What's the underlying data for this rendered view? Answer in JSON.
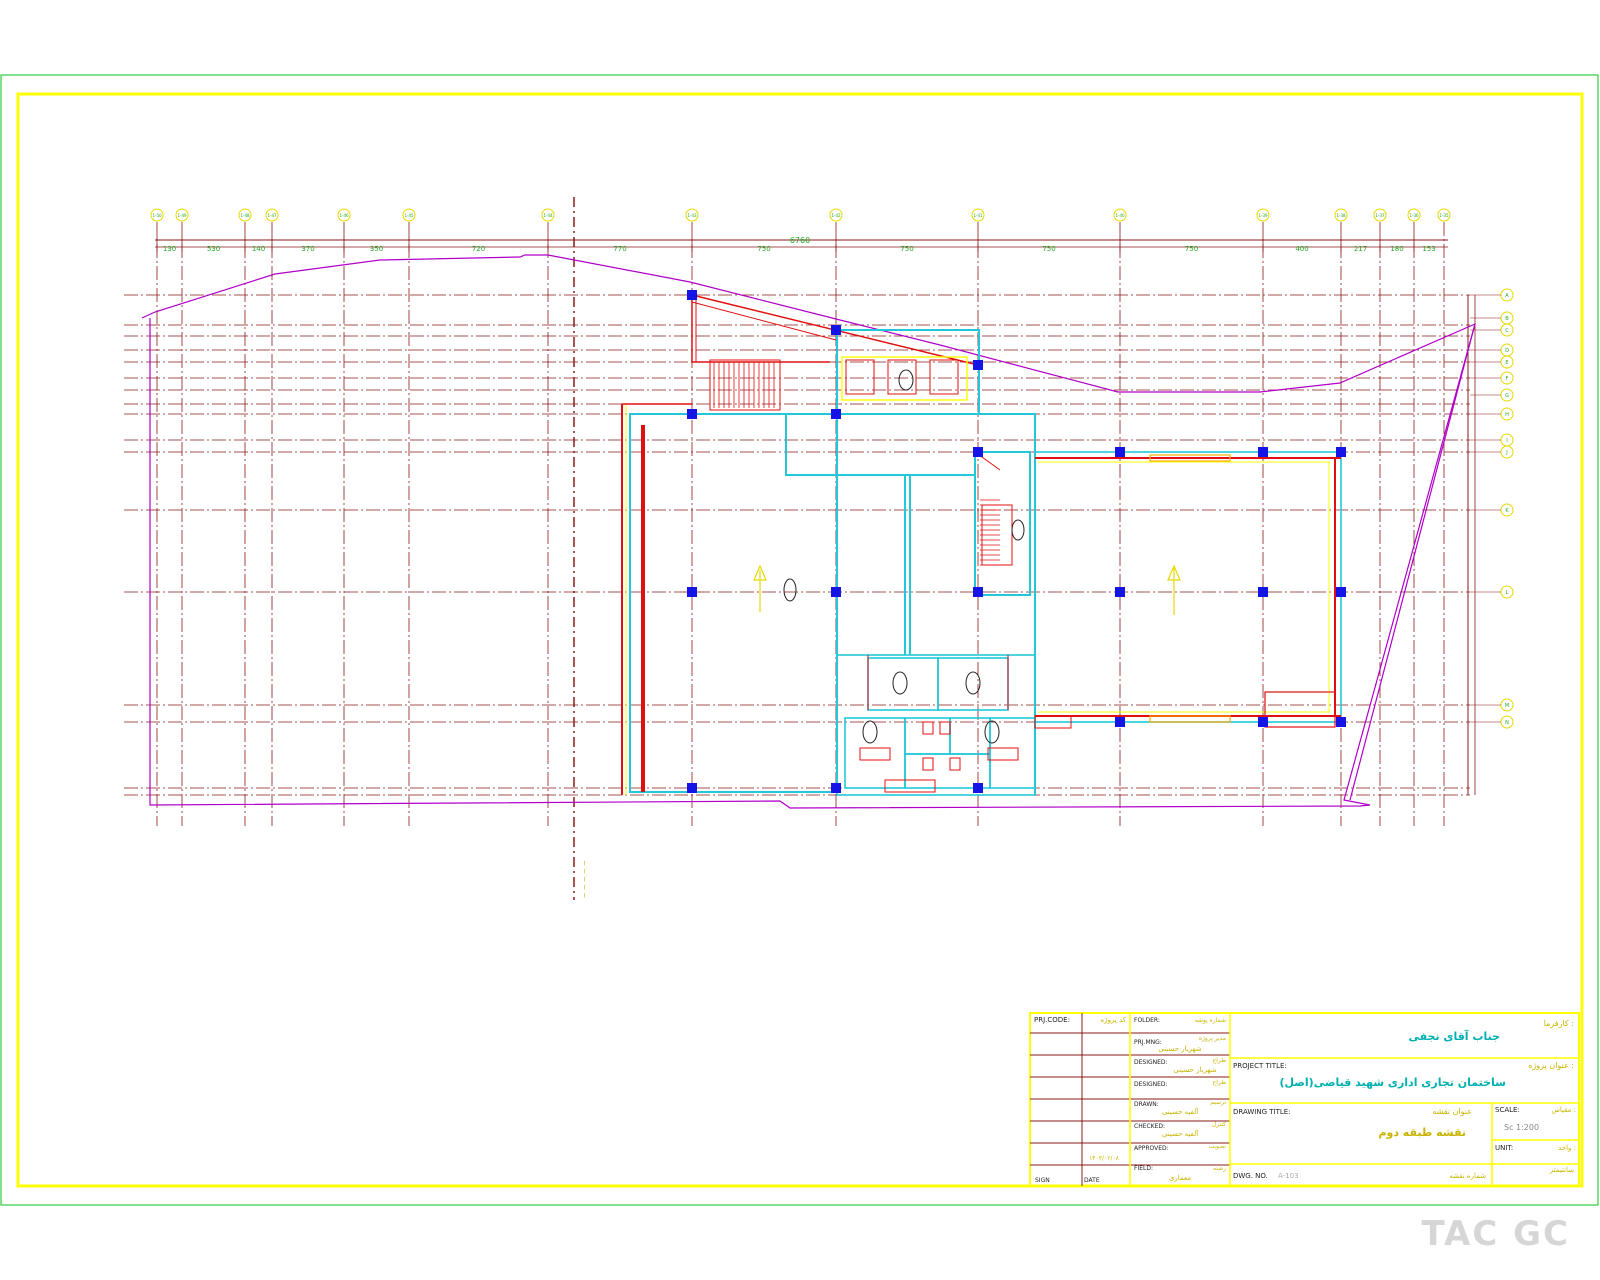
{
  "colors": {
    "sheet_border": "#2ecc40",
    "frame": "#ffff00",
    "grid": "#8b1a1a",
    "property_line": "#b000c8",
    "walls": "#22c8d8",
    "column": "#1414e6",
    "dimension": "#22aa22",
    "red": "#e01010",
    "tb_lines": "#8b1a1a",
    "tb_text": "#c8b400",
    "tb_label": "#222222",
    "tb_cyan": "#00b0b0",
    "watermark": "#d6d6d6"
  },
  "axes_top": [
    "1-50",
    "1-49",
    "1-48",
    "1-47",
    "1-46",
    "1-45",
    "1-44",
    "1-43",
    "1-42",
    "1-41",
    "1-40",
    "1-39",
    "1-38",
    "1-37",
    "1-36",
    "1-35"
  ],
  "axes_right": [
    "A",
    "B",
    "C",
    "D",
    "E",
    "F",
    "G",
    "H",
    "I",
    "J",
    "K",
    "L",
    "M",
    "N"
  ],
  "dims_top": {
    "overall": "6760",
    "segments": [
      "130",
      "530",
      "140",
      "370",
      "350",
      "720",
      "770",
      "750",
      "750",
      "750",
      "750",
      "400",
      "217",
      "180",
      "153"
    ]
  },
  "title_block": {
    "prj_code_label": "PRJ.CODE:",
    "prj_code_fa": "کد پروژه",
    "folder_label": "FOLDER:",
    "folder_fa": "شماره پوشه",
    "planning_label": "PRJ.MNG:",
    "planning_fa": "مدیر پروژه",
    "planning_value": "شهریار حسینی",
    "designed1_label": "DESIGNED:",
    "designed1_fa": "طراح",
    "designed1_value": "شهریار حسینی",
    "designed2_label": "DESIGNED:",
    "designed2_fa": "طراح",
    "drawn_label": "DRAWN:",
    "drawn_fa": "ترسیم",
    "drawn_value": "آلفیه حسینی",
    "checked_label": "CHECKED:",
    "checked_fa": "کنترل",
    "checked_value": "آلفیه حسینی",
    "approved_label": "APPROVED:",
    "approved_fa": "تصویب",
    "date_value": "۱۴۰۳/۰۲/۰۸",
    "field_label": "FIELD:",
    "field_fa": "رشته",
    "field_value": "معماری",
    "sign_label": "SIGN",
    "date_label": "DATE",
    "employer_fa": "کارفرما :",
    "employer_value": "جناب آقای نجفی",
    "project_title_label": "PROJECT TITLE:",
    "project_title_fa": "عنوان پروژه :",
    "project_title_value": "ساختمان تجاری اداری شهید قیاضی(اصل)",
    "drawing_title_label": "DRAWING TITLE:",
    "drawing_title_fa": "عنوان نقشه",
    "drawing_title_value": "نقشه طبقه دوم",
    "scale_label": "SCALE:",
    "scale_fa": "مقیاس :",
    "scale_value": "Sc 1:200",
    "unit_label": "UNIT:",
    "unit_fa": "واحد :",
    "unit_value": "سانتیمتر",
    "dwg_no_label": "DWG. NO.",
    "dwg_no_value": "A-103",
    "sheet_fa": "شماره نقشه"
  },
  "watermark": "TAC GC"
}
